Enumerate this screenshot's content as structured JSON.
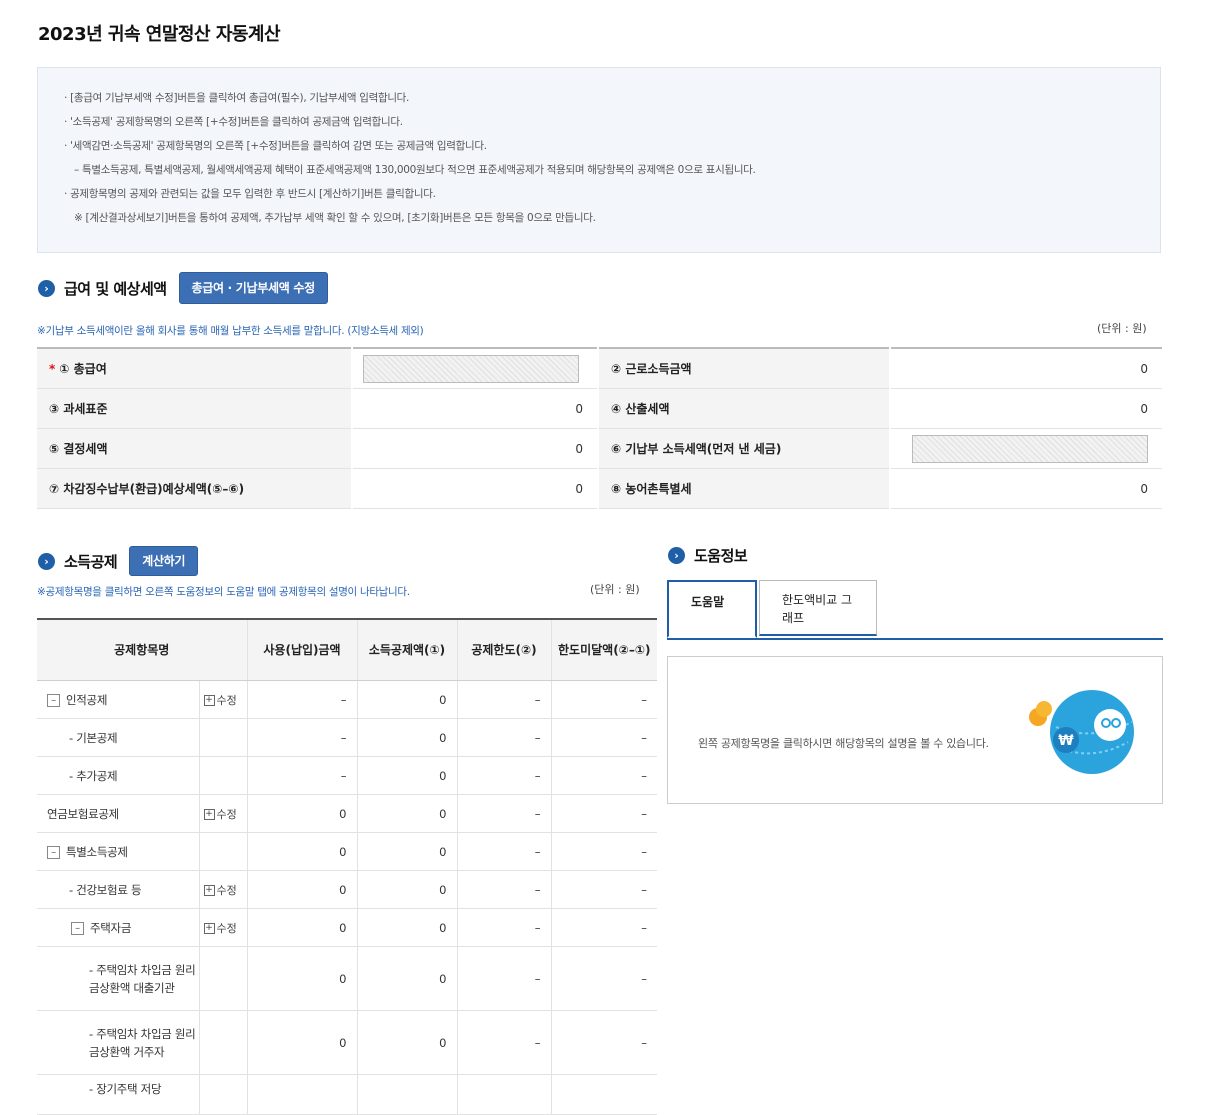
{
  "page": {
    "title": "2023년 귀속 연말정산 자동계산"
  },
  "notice": {
    "lines": [
      "· [총급여 기납부세액 수정]버튼을 클릭하여 총급여(필수), 기납부세액 입력합니다.",
      "· '소득공제' 공제항목명의 오른쪽 [+수정]버튼을 클릭하여 공제금액 입력합니다.",
      "· '세액감면·소득공제' 공제항목명의 오른쪽 [+수정]버튼을 클릭하여 감면 또는 공제금액 입력합니다.",
      "– 특별소득공제, 특별세액공제, 월세액세액공제 혜택이 표준세액공제액 130,000원보다 적으면 표준세액공제가 적용되며 해당항목의 공제액은 0으로 표시됩니다.",
      "· 공제항목명의 공제와 관련되는 값을 모두 입력한 후 반드시 [계산하기]버튼 클릭합니다.",
      "※ [계산결과상세보기]버튼을 통하여 공제액, 추가납부 세액 확인 할 수 있으며, [초기화]버튼은 모든 항목을 0으로 만듭니다."
    ]
  },
  "salary": {
    "title": "급여 및 예상세액",
    "edit_button": "총급여 · 기납부세액 수정",
    "note": "※기납부 소득세액이란 올해 회사를 통해 매월 납부한 소득세를 말합니다. (지방소득세 제외)",
    "unit": "(단위 : 원)",
    "required_mark": "*",
    "fields": [
      {
        "label": "① 총급여",
        "value": ""
      },
      {
        "label": "② 근로소득금액",
        "value": "0"
      },
      {
        "label": "③ 과세표준",
        "value": "0"
      },
      {
        "label": "④ 산출세액",
        "value": "0"
      },
      {
        "label": "⑤ 결정세액",
        "value": "0"
      },
      {
        "label": "⑥ 기납부 소득세액(먼저 낸 세금)",
        "value": ""
      },
      {
        "label": "⑦ 차감징수납부(환급)예상세액(⑤–⑥)",
        "value": "0"
      },
      {
        "label": "⑧ 농어촌특별세",
        "value": "0"
      }
    ]
  },
  "deduction": {
    "title": "소득공제",
    "calc_button": "계산하기",
    "note": "※공제항목명을 클릭하면 오른쪽 도움정보의 도움말 탭에 공제항목의 설명이 나타납니다.",
    "unit": "(단위 : 원)",
    "headers": [
      "공제항목명",
      "사용(납입)금액",
      "소득공제액(①)",
      "공제한도(②)",
      "한도미달액(②–①)"
    ],
    "rows": [
      {
        "name": "인적공제",
        "toggle": "–",
        "edit": "수정",
        "amount": "–",
        "ded": "0",
        "limit": "–",
        "short": "–"
      },
      {
        "name": "- 기본공제",
        "toggle": "",
        "edit": "",
        "amount": "–",
        "ded": "0",
        "limit": "–",
        "short": "–"
      },
      {
        "name": "- 추가공제",
        "toggle": "",
        "edit": "",
        "amount": "–",
        "ded": "0",
        "limit": "–",
        "short": "–"
      },
      {
        "name": "연금보험료공제",
        "toggle": "",
        "edit": "수정",
        "amount": "0",
        "ded": "0",
        "limit": "–",
        "short": "–"
      },
      {
        "name": "특별소득공제",
        "toggle": "–",
        "edit": "",
        "amount": "0",
        "ded": "0",
        "limit": "–",
        "short": "–"
      },
      {
        "name": "- 건강보험료 등",
        "toggle": "",
        "edit": "수정",
        "amount": "0",
        "ded": "0",
        "limit": "–",
        "short": "–"
      },
      {
        "name": "주택자금",
        "toggle": "–",
        "edit": "수정",
        "amount": "0",
        "ded": "0",
        "limit": "–",
        "short": "–"
      },
      {
        "name": "- 주택임차 차입금 원리금상환액 대출기관",
        "toggle": "",
        "edit": "",
        "amount": "0",
        "ded": "0",
        "limit": "–",
        "short": "–"
      },
      {
        "name": "- 주택임차 차입금 원리금상환액 거주자",
        "toggle": "",
        "edit": "",
        "amount": "0",
        "ded": "0",
        "limit": "–",
        "short": "–"
      },
      {
        "name": "- 장기주택 저당",
        "toggle": "",
        "edit": "",
        "amount": "",
        "ded": "",
        "limit": "",
        "short": ""
      }
    ]
  },
  "help": {
    "title": "도움정보",
    "tabs": [
      "도움말",
      "한도액비교 그래프"
    ],
    "text": "왼쪽 공제항목명을 클릭하시면 해당항목의 설명을 볼 수 있습니다.",
    "art_symbol": "₩"
  },
  "colors": {
    "accent": "#1f5fa8",
    "button": "#3d6fb5",
    "note_blue": "#2a65b5",
    "notice_bg": "#f3f6fb"
  }
}
